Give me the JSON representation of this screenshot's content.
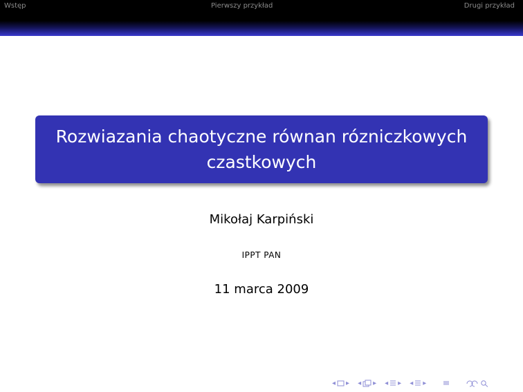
{
  "header": {
    "nav_sections": [
      "Wstęp",
      "Pierwszy przykład",
      "Drugi przykład"
    ]
  },
  "title_slide": {
    "title": "Rozwiazania chaotyczne równan rózniczkowych czastkowych",
    "author": "Mikołaj Karpiński",
    "institute": "IPPT PAN",
    "date": "11 marca 2009"
  },
  "colors": {
    "header_bg": "#000000",
    "title_box": "#3333b3",
    "nav_text": "#8c8c8c",
    "navigation_symbols": "#8f8fd6"
  },
  "icons": [
    "left-arrow-icon",
    "frame-icon",
    "right-arrow-icon",
    "subsection-icon",
    "section-icon",
    "align-icon",
    "back-forward-search-icon"
  ]
}
